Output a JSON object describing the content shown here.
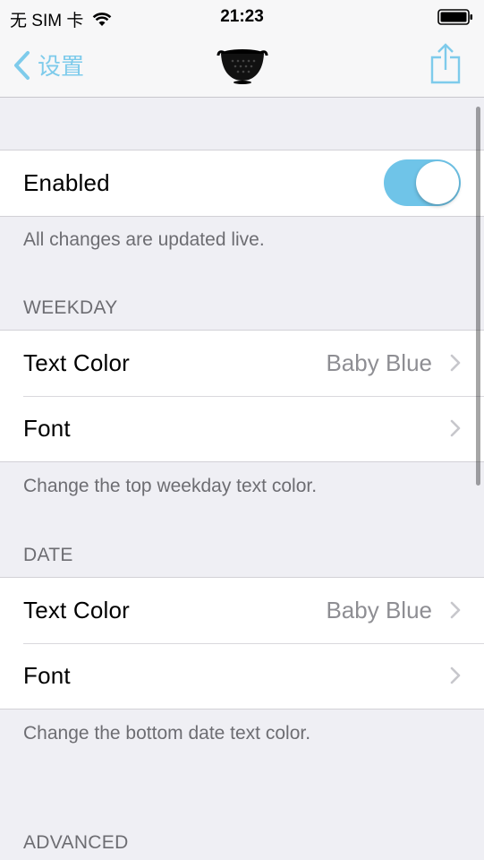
{
  "status_bar": {
    "carrier": "无 SIM 卡",
    "time": "21:23"
  },
  "nav": {
    "back_label": "设置",
    "back_icon": "chevron-left-icon",
    "logo_icon": "colander-logo-icon",
    "share_icon": "share-icon"
  },
  "sections": {
    "enabled": {
      "label": "Enabled",
      "toggle_on": true,
      "footer": "All changes are updated live."
    },
    "weekday": {
      "header": "WEEKDAY",
      "text_color_label": "Text Color",
      "text_color_value": "Baby Blue",
      "font_label": "Font",
      "footer": "Change the top weekday text color."
    },
    "date": {
      "header": "DATE",
      "text_color_label": "Text Color",
      "text_color_value": "Baby Blue",
      "font_label": "Font",
      "footer": "Change the bottom date text color."
    },
    "advanced": {
      "header": "ADVANCED"
    }
  },
  "colors": {
    "accent": "#7ecbeb",
    "toggle_on": "#6fc4e8",
    "background": "#efeff4"
  }
}
